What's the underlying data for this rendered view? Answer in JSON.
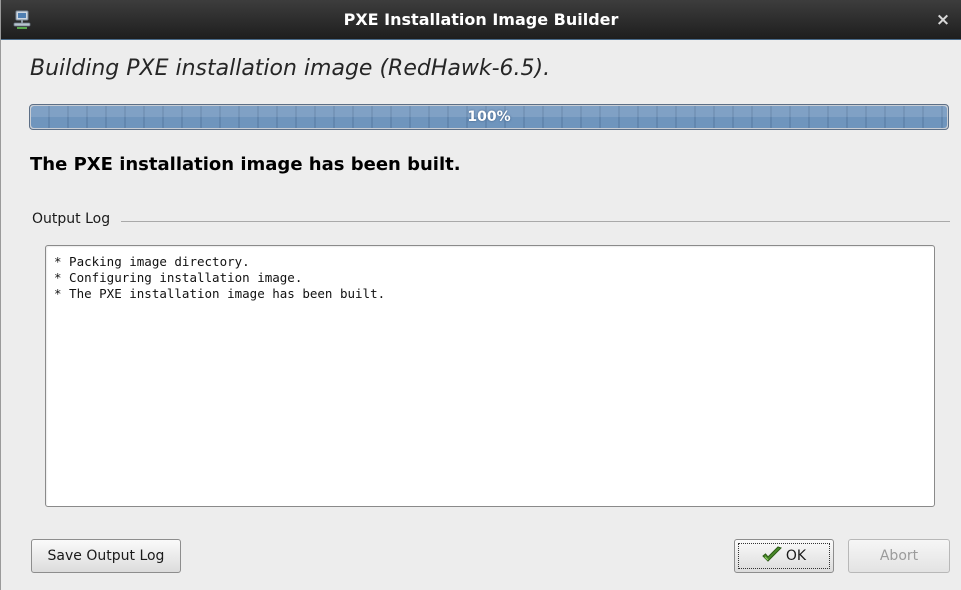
{
  "window": {
    "title": "PXE Installation Image Builder",
    "close_glyph": "×",
    "app_icon": "network-computer-icon"
  },
  "heading": "Building PXE installation image (RedHawk-6.5).",
  "progress": {
    "value": 1.0,
    "label": "100%"
  },
  "status_message": "The PXE installation image has been built.",
  "output_log": {
    "label": "Output Log",
    "lines": [
      "* Packing image directory.",
      "* Configuring installation image.",
      "* The PXE installation image has been built."
    ]
  },
  "buttons": {
    "save_log": "Save Output Log",
    "ok": "OK",
    "ok_icon": "checkmark-icon",
    "abort": "Abort",
    "abort_enabled": false
  },
  "colors": {
    "progress_fill": "#6f95bd",
    "titlebar": "#2a2a2a",
    "window_bg": "#ededed"
  }
}
